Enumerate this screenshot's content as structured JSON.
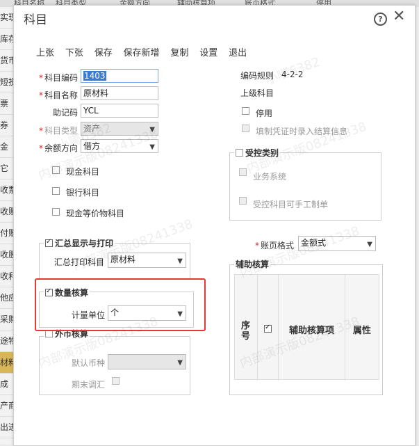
{
  "background": {
    "header_columns": [
      "科目名称",
      "科目类型",
      "余额方向",
      "辅助核算项",
      "账页格式",
      "停用"
    ],
    "left_rows": [
      "实现",
      "库存",
      "货币",
      "短投",
      "票",
      "券",
      "金",
      "它",
      "收票",
      "收账",
      "付账",
      "收股",
      "收利",
      "他应",
      "采购",
      "途物",
      "材料",
      "成",
      "产商",
      "出进",
      "加"
    ],
    "left_selected_index": 16
  },
  "dialog": {
    "title": "科目",
    "help_symbol": "?",
    "close_symbol": "✕"
  },
  "toolbar": [
    "上张",
    "下张",
    "保存",
    "保存新增",
    "复制",
    "设置",
    "退出"
  ],
  "form": {
    "code": {
      "label": "科目编码",
      "value": "1403"
    },
    "name": {
      "label": "科目名称",
      "value": "原材料"
    },
    "mnemonic": {
      "label": "助记码",
      "value": "YCL"
    },
    "type": {
      "label": "科目类型",
      "value": "资产"
    },
    "balance_direction": {
      "label": "余额方向",
      "value": "借方"
    },
    "cash_account": "现金科目",
    "bank_account": "银行科目",
    "cash_equivalent": "现金等价物科目"
  },
  "right": {
    "coding_rule_label": "编码规则",
    "coding_rule_value": "4-2-2",
    "parent_label": "上级科目",
    "disabled_label": "停用",
    "voucher_label": "填制凭证时录入结算信息",
    "controlled": {
      "title": "受控类别",
      "business": "业务系统",
      "manual": "受控科目可手工制单"
    },
    "ledger_format": {
      "label": "账页格式",
      "value": "金额式"
    },
    "aux": {
      "title": "辅助核算",
      "col_seq": "序号",
      "col_item": "辅助核算项",
      "col_attr": "属性"
    }
  },
  "summary": {
    "title": "汇总显示与打印",
    "print_label": "汇总打印科目",
    "print_value": "原材料"
  },
  "quantity": {
    "title": "数量核算",
    "unit_label": "计量单位",
    "unit_value": "个"
  },
  "foreign": {
    "title": "外币核算",
    "currency_label": "默认币种",
    "currency_value": "",
    "adjust_label": "期末调汇"
  },
  "watermarks": [
    "小嘟6382",
    "内部演示版08241338"
  ]
}
